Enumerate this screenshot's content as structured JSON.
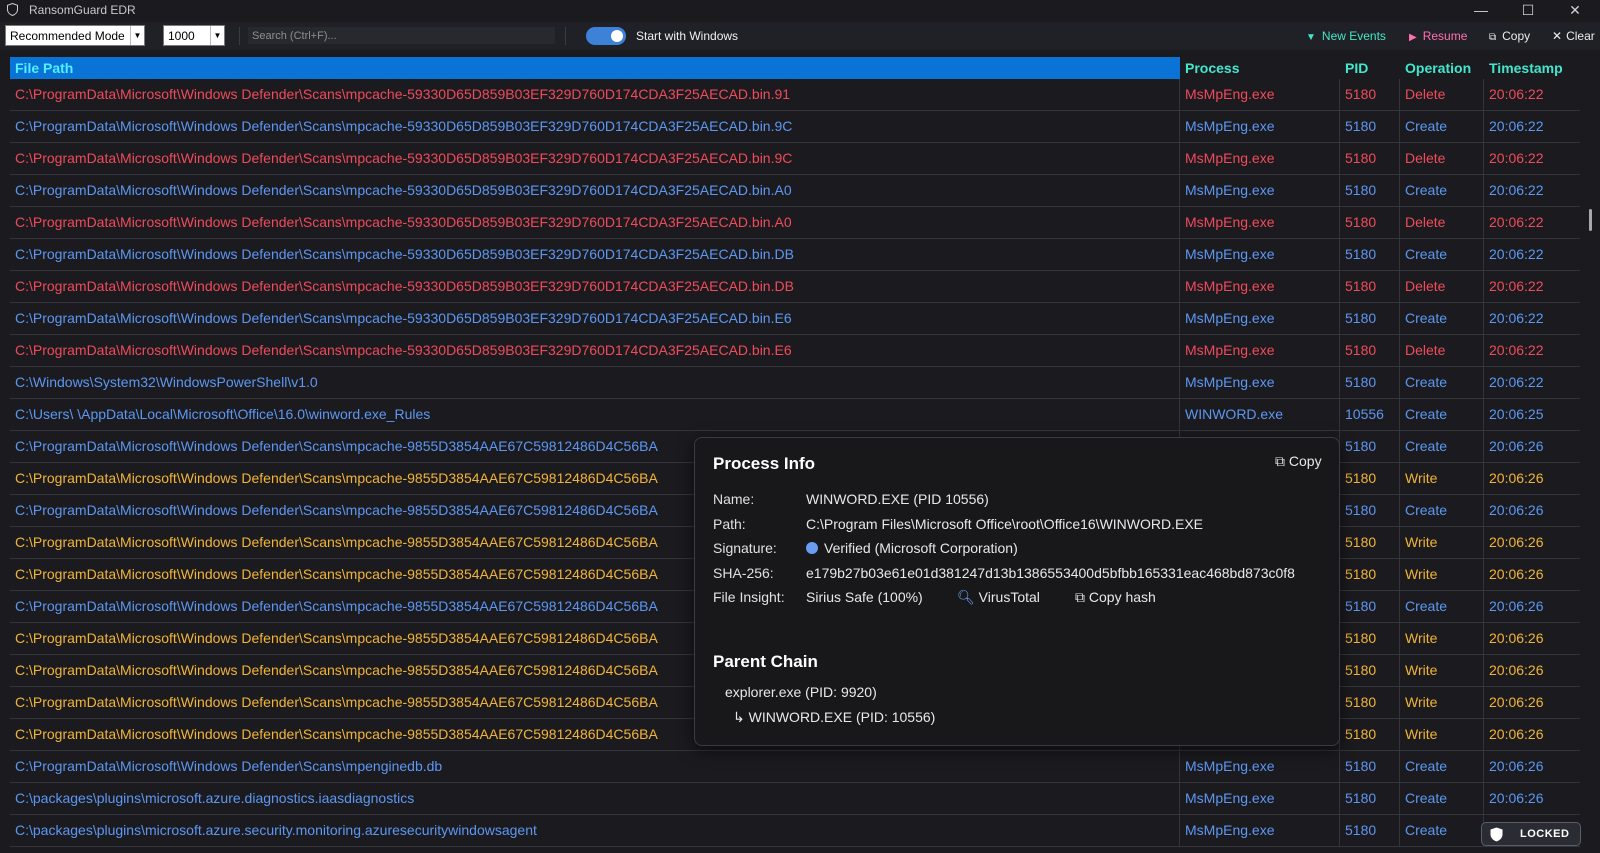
{
  "window": {
    "title": "RansomGuard EDR",
    "minimize": "—",
    "maximize": "☐",
    "close": "✕"
  },
  "toolbar": {
    "mode": "Recommended Mode",
    "count": "1000",
    "search_placeholder": "Search (Ctrl+F)...",
    "toggle_label": "Start with Windows",
    "toggle_on": true,
    "new_events": "New Events",
    "resume": "Resume",
    "copy": "Copy",
    "clear": "Clear"
  },
  "table": {
    "headers": {
      "path": "File Path",
      "process": "Process",
      "pid": "PID",
      "operation": "Operation",
      "timestamp": "Timestamp"
    },
    "rows": [
      {
        "path": "C:\\ProgramData\\Microsoft\\Windows Defender\\Scans\\mpcache-59330D65D859B03EF329D760D174CDA3F25AECAD.bin.91",
        "process": "MsMpEng.exe",
        "pid": "5180",
        "op": "Delete",
        "ts": "20:06:22",
        "kind": "delete"
      },
      {
        "path": "C:\\ProgramData\\Microsoft\\Windows Defender\\Scans\\mpcache-59330D65D859B03EF329D760D174CDA3F25AECAD.bin.9C",
        "process": "MsMpEng.exe",
        "pid": "5180",
        "op": "Create",
        "ts": "20:06:22",
        "kind": "create"
      },
      {
        "path": "C:\\ProgramData\\Microsoft\\Windows Defender\\Scans\\mpcache-59330D65D859B03EF329D760D174CDA3F25AECAD.bin.9C",
        "process": "MsMpEng.exe",
        "pid": "5180",
        "op": "Delete",
        "ts": "20:06:22",
        "kind": "delete"
      },
      {
        "path": "C:\\ProgramData\\Microsoft\\Windows Defender\\Scans\\mpcache-59330D65D859B03EF329D760D174CDA3F25AECAD.bin.A0",
        "process": "MsMpEng.exe",
        "pid": "5180",
        "op": "Create",
        "ts": "20:06:22",
        "kind": "create"
      },
      {
        "path": "C:\\ProgramData\\Microsoft\\Windows Defender\\Scans\\mpcache-59330D65D859B03EF329D760D174CDA3F25AECAD.bin.A0",
        "process": "MsMpEng.exe",
        "pid": "5180",
        "op": "Delete",
        "ts": "20:06:22",
        "kind": "delete"
      },
      {
        "path": "C:\\ProgramData\\Microsoft\\Windows Defender\\Scans\\mpcache-59330D65D859B03EF329D760D174CDA3F25AECAD.bin.DB",
        "process": "MsMpEng.exe",
        "pid": "5180",
        "op": "Create",
        "ts": "20:06:22",
        "kind": "create"
      },
      {
        "path": "C:\\ProgramData\\Microsoft\\Windows Defender\\Scans\\mpcache-59330D65D859B03EF329D760D174CDA3F25AECAD.bin.DB",
        "process": "MsMpEng.exe",
        "pid": "5180",
        "op": "Delete",
        "ts": "20:06:22",
        "kind": "delete"
      },
      {
        "path": "C:\\ProgramData\\Microsoft\\Windows Defender\\Scans\\mpcache-59330D65D859B03EF329D760D174CDA3F25AECAD.bin.E6",
        "process": "MsMpEng.exe",
        "pid": "5180",
        "op": "Create",
        "ts": "20:06:22",
        "kind": "create"
      },
      {
        "path": "C:\\ProgramData\\Microsoft\\Windows Defender\\Scans\\mpcache-59330D65D859B03EF329D760D174CDA3F25AECAD.bin.E6",
        "process": "MsMpEng.exe",
        "pid": "5180",
        "op": "Delete",
        "ts": "20:06:22",
        "kind": "delete"
      },
      {
        "path": "C:\\Windows\\System32\\WindowsPowerShell\\v1.0",
        "process": "MsMpEng.exe",
        "pid": "5180",
        "op": "Create",
        "ts": "20:06:22",
        "kind": "create"
      },
      {
        "path": "C:\\Users\\        \\AppData\\Local\\Microsoft\\Office\\16.0\\winword.exe_Rules",
        "process": "WINWORD.exe",
        "pid": "10556",
        "op": "Create",
        "ts": "20:06:25",
        "kind": "create"
      },
      {
        "path": "C:\\ProgramData\\Microsoft\\Windows Defender\\Scans\\mpcache-9855D3854AAE67C59812486D4C56BA",
        "process": "",
        "pid": "5180",
        "op": "Create",
        "ts": "20:06:26",
        "kind": "create"
      },
      {
        "path": "C:\\ProgramData\\Microsoft\\Windows Defender\\Scans\\mpcache-9855D3854AAE67C59812486D4C56BA",
        "process": "",
        "pid": "5180",
        "op": "Write",
        "ts": "20:06:26",
        "kind": "write"
      },
      {
        "path": "C:\\ProgramData\\Microsoft\\Windows Defender\\Scans\\mpcache-9855D3854AAE67C59812486D4C56BA",
        "process": "",
        "pid": "5180",
        "op": "Create",
        "ts": "20:06:26",
        "kind": "create"
      },
      {
        "path": "C:\\ProgramData\\Microsoft\\Windows Defender\\Scans\\mpcache-9855D3854AAE67C59812486D4C56BA",
        "process": "",
        "pid": "5180",
        "op": "Write",
        "ts": "20:06:26",
        "kind": "write"
      },
      {
        "path": "C:\\ProgramData\\Microsoft\\Windows Defender\\Scans\\mpcache-9855D3854AAE67C59812486D4C56BA",
        "process": "",
        "pid": "5180",
        "op": "Write",
        "ts": "20:06:26",
        "kind": "write"
      },
      {
        "path": "C:\\ProgramData\\Microsoft\\Windows Defender\\Scans\\mpcache-9855D3854AAE67C59812486D4C56BA",
        "process": "",
        "pid": "5180",
        "op": "Create",
        "ts": "20:06:26",
        "kind": "create"
      },
      {
        "path": "C:\\ProgramData\\Microsoft\\Windows Defender\\Scans\\mpcache-9855D3854AAE67C59812486D4C56BA",
        "process": "",
        "pid": "5180",
        "op": "Write",
        "ts": "20:06:26",
        "kind": "write"
      },
      {
        "path": "C:\\ProgramData\\Microsoft\\Windows Defender\\Scans\\mpcache-9855D3854AAE67C59812486D4C56BA",
        "process": "",
        "pid": "5180",
        "op": "Write",
        "ts": "20:06:26",
        "kind": "write"
      },
      {
        "path": "C:\\ProgramData\\Microsoft\\Windows Defender\\Scans\\mpcache-9855D3854AAE67C59812486D4C56BA",
        "process": "",
        "pid": "5180",
        "op": "Write",
        "ts": "20:06:26",
        "kind": "write"
      },
      {
        "path": "C:\\ProgramData\\Microsoft\\Windows Defender\\Scans\\mpcache-9855D3854AAE67C59812486D4C56BA",
        "process": "",
        "pid": "5180",
        "op": "Write",
        "ts": "20:06:26",
        "kind": "write"
      },
      {
        "path": "C:\\ProgramData\\Microsoft\\Windows Defender\\Scans\\mpenginedb.db",
        "process": "MsMpEng.exe",
        "pid": "5180",
        "op": "Create",
        "ts": "20:06:26",
        "kind": "create"
      },
      {
        "path": "C:\\packages\\plugins\\microsoft.azure.diagnostics.iaasdiagnostics",
        "process": "MsMpEng.exe",
        "pid": "5180",
        "op": "Create",
        "ts": "20:06:26",
        "kind": "create"
      },
      {
        "path": "C:\\packages\\plugins\\microsoft.azure.security.monitoring.azuresecuritywindowsagent",
        "process": "MsMpEng.exe",
        "pid": "5180",
        "op": "Create",
        "ts": "",
        "kind": "create"
      }
    ]
  },
  "process_info": {
    "title": "Process Info",
    "copy_label": "Copy",
    "name_label": "Name:",
    "name_value": "WINWORD.EXE (PID 10556)",
    "path_label": "Path:",
    "path_value": "C:\\Program Files\\Microsoft Office\\root\\Office16\\WINWORD.EXE",
    "signature_label": "Signature:",
    "signature_value": "Verified (Microsoft Corporation)",
    "sha_label": "SHA-256:",
    "sha_value": "e179b27b03e61e01d381247d13b1386553400d5bfbb165331eac468bd873c0f8",
    "insight_label": "File Insight:",
    "insight_value": "Sirius Safe (100%)",
    "virustotal": "VirusTotal",
    "copy_hash": "Copy hash",
    "chain_title": "Parent Chain",
    "chain": [
      "explorer.exe (PID: 9920)",
      "↳ WINWORD.EXE (PID: 10556)"
    ]
  },
  "locked_badge": "LOCKED",
  "colors": {
    "delete": "#ef4b5a",
    "create": "#5d97f2",
    "write": "#f2b438",
    "header_accent": "#43e6cd",
    "path_header_bg": "#0a74d6"
  }
}
